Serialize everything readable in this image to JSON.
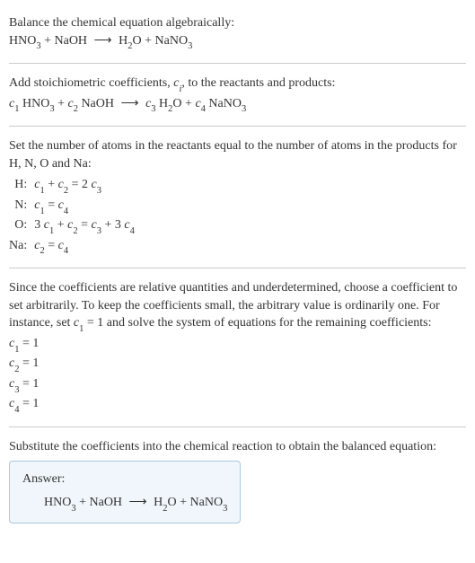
{
  "intro": {
    "line1": "Balance the chemical equation algebraically:",
    "eq_lhs1": "HNO",
    "eq_lhs1_sub": "3",
    "plus": " + ",
    "eq_lhs2": "NaOH",
    "arrow": "⟶",
    "eq_rhs1": "H",
    "eq_rhs1_sub": "2",
    "eq_rhs1b": "O",
    "eq_rhs2": "NaNO",
    "eq_rhs2_sub": "3"
  },
  "step1": {
    "text": "Add stoichiometric coefficients, ",
    "ci": "c",
    "ci_sub": "i",
    "text2": ", to the reactants and products:",
    "c1": "c",
    "c1s": "1",
    "sp1": " HNO",
    "sp1s": "3",
    "c2": "c",
    "c2s": "2",
    "sp2": " NaOH",
    "c3": "c",
    "c3s": "3",
    "sp3": " H",
    "sp3s": "2",
    "sp3b": "O",
    "c4": "c",
    "c4s": "4",
    "sp4": " NaNO",
    "sp4s": "3"
  },
  "step2": {
    "text": "Set the number of atoms in the reactants equal to the number of atoms in the products for H, N, O and Na:",
    "rows": [
      {
        "label": "H:",
        "lhs_a": "c",
        "lhs_as": "1",
        "lhs_plus": " + ",
        "lhs_b": "c",
        "lhs_bs": "2",
        "eq": " = ",
        "rhs_a": "2 ",
        "rhs_b": "c",
        "rhs_bs": "3"
      },
      {
        "label": "N:",
        "lhs_a": "c",
        "lhs_as": "1",
        "eq": " = ",
        "rhs_b": "c",
        "rhs_bs": "4"
      },
      {
        "label": "O:",
        "lhs_pre": "3 ",
        "lhs_a": "c",
        "lhs_as": "1",
        "lhs_plus": " + ",
        "lhs_b": "c",
        "lhs_bs": "2",
        "eq": " = ",
        "rhs_b": "c",
        "rhs_bs": "3",
        "rhs_plus": " + 3 ",
        "rhs_c": "c",
        "rhs_cs": "4"
      },
      {
        "label": "Na:",
        "lhs_a": "c",
        "lhs_as": "2",
        "eq": " = ",
        "rhs_b": "c",
        "rhs_bs": "4"
      }
    ]
  },
  "step3": {
    "text_a": "Since the coefficients are relative quantities and underdetermined, choose a coefficient to set arbitrarily. To keep the coefficients small, the arbitrary value is ordinarily one. For instance, set ",
    "c1": "c",
    "c1s": "1",
    "text_b": " = 1 and solve the system of equations for the remaining coefficients:",
    "sol": [
      {
        "c": "c",
        "cs": "1",
        "val": " = 1"
      },
      {
        "c": "c",
        "cs": "2",
        "val": " = 1"
      },
      {
        "c": "c",
        "cs": "3",
        "val": " = 1"
      },
      {
        "c": "c",
        "cs": "4",
        "val": " = 1"
      }
    ]
  },
  "step4": {
    "text": "Substitute the coefficients into the chemical reaction to obtain the balanced equation:"
  },
  "answer": {
    "label": "Answer:",
    "lhs1": "HNO",
    "lhs1s": "3",
    "plus": " + ",
    "lhs2": "NaOH",
    "arrow": "⟶",
    "rhs1": "H",
    "rhs1s": "2",
    "rhs1b": "O",
    "rhs2": "NaNO",
    "rhs2s": "3"
  }
}
